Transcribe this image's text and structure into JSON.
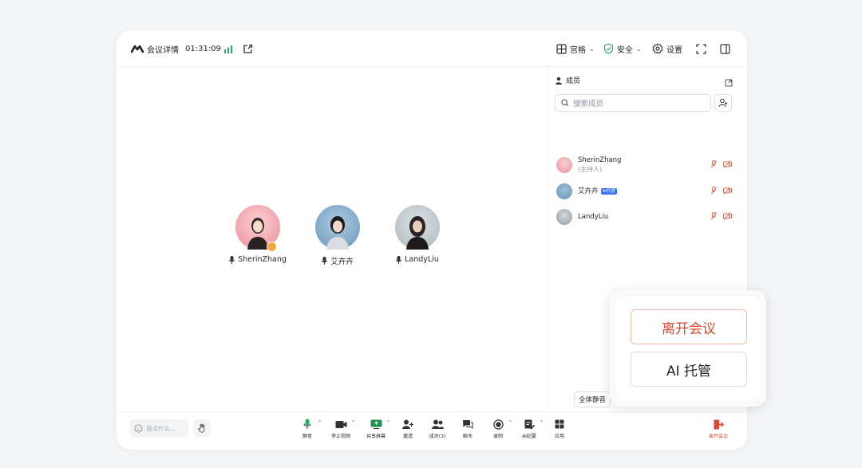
{
  "header": {
    "title": "会议详情",
    "timer": "01:31:09",
    "layout_label": "宫格",
    "security_label": "安全",
    "settings_label": "设置"
  },
  "participants": [
    {
      "name": "SherinZhang",
      "host": true
    },
    {
      "name": "艾卉卉",
      "host": false
    },
    {
      "name": "LandyLiu",
      "host": false
    }
  ],
  "panel": {
    "title": "成员",
    "search_placeholder": "搜索成员",
    "members": [
      {
        "name": "SherinZhang",
        "sub": "(主持人)",
        "tag": ""
      },
      {
        "name": "艾卉卉",
        "sub": "",
        "tag": "AI托管"
      },
      {
        "name": "LandyLiu",
        "sub": "",
        "tag": ""
      }
    ],
    "mute_all_label": "全体静音"
  },
  "bottom": {
    "chat_placeholder": "说点什么...",
    "tools": [
      {
        "label": "静音"
      },
      {
        "label": "停止视频"
      },
      {
        "label": "共享屏幕"
      },
      {
        "label": "邀请"
      },
      {
        "label": "成员(3)"
      },
      {
        "label": "聊天"
      },
      {
        "label": "录制"
      },
      {
        "label": "AI纪要"
      },
      {
        "label": "应用"
      }
    ],
    "leave_label": "离开会议"
  },
  "popover": {
    "leave_label": "离开会议",
    "ai_label": "AI 托管"
  },
  "colors": {
    "accent_green": "#22b35e",
    "leave_red": "#e0472f",
    "ai_tag_blue": "#3370ff"
  }
}
